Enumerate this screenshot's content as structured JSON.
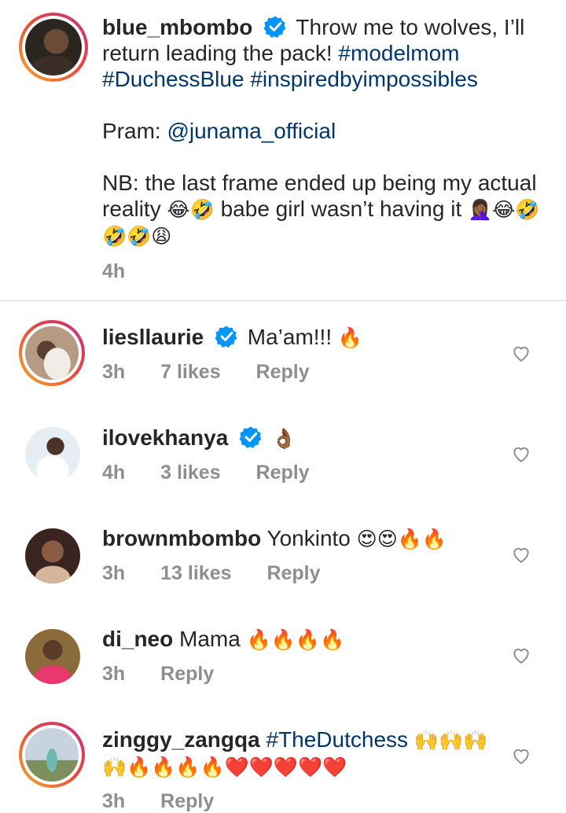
{
  "post": {
    "username": "blue_mbombo",
    "text1": "Throw me to wolves, I’ll return leading the pack!",
    "hashtags": [
      "#modelmom",
      "#DuchessBlue",
      "#inspiredbyimpossibles"
    ],
    "pram_label": "Pram:",
    "pram_mention": "@junama_official",
    "nb_text": "NB: the last frame ended up being my actual reality",
    "nb_emoji1": "😂🤣",
    "nb_text2": "babe girl wasn’t having it",
    "nb_emoji2": "🤦🏾‍♀️😂🤣🤣🤣😩",
    "time": "4h"
  },
  "comments": [
    {
      "username": "liesllaurie",
      "verified": true,
      "text": "Ma’am!!!",
      "emoji": "🔥",
      "time": "3h",
      "likes": "7 likes",
      "reply": "Reply"
    },
    {
      "username": "ilovekhanya",
      "verified": true,
      "text": "",
      "emoji": "👌🏾",
      "time": "4h",
      "likes": "3 likes",
      "reply": "Reply"
    },
    {
      "username": "brownmbombo",
      "verified": false,
      "text": "Yonkinto",
      "emoji": "😍😍🔥🔥",
      "time": "3h",
      "likes": "13 likes",
      "reply": "Reply"
    },
    {
      "username": "di_neo",
      "verified": false,
      "text": "Mama",
      "emoji": "🔥🔥🔥🔥",
      "time": "3h",
      "likes": "",
      "reply": "Reply"
    },
    {
      "username": "zinggy_zangqa",
      "verified": false,
      "text": "#TheDutchess",
      "emoji": "🙌🙌🙌",
      "emoji2": "🙌🔥🔥🔥🔥❤️❤️❤️❤️❤️",
      "time": "3h",
      "likes": "",
      "reply": "Reply"
    }
  ],
  "colors": {
    "link": "#00376b",
    "meta": "#8e8e8e",
    "verified": "#0095f6"
  }
}
